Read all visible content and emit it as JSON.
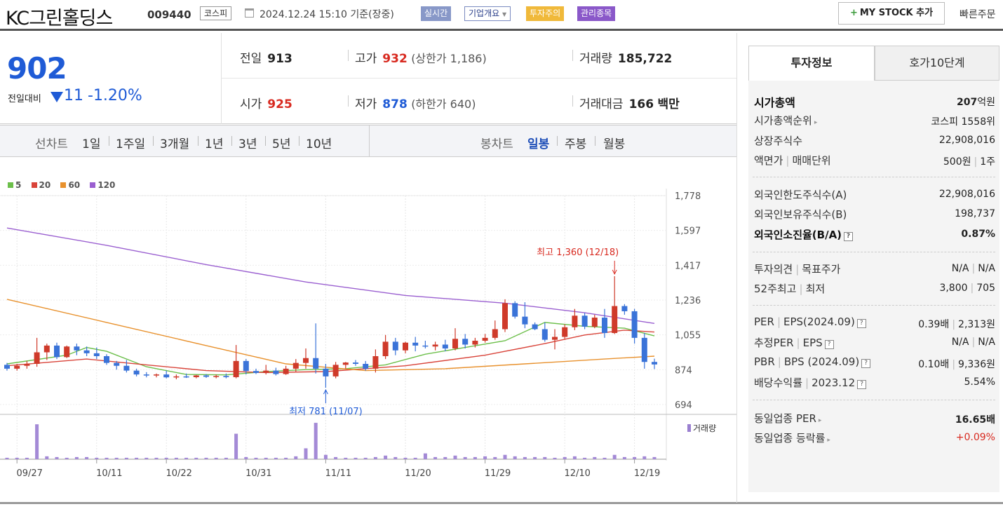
{
  "header": {
    "name": "KC그린홀딩스",
    "code": "009440",
    "market": "코스피",
    "datetime": "2024.12.24 15:10",
    "basis": "기준(장중)",
    "badges": {
      "realtime": "실시간",
      "company": "기업개요",
      "caution": "투자주의",
      "managed": "관리종목"
    },
    "badge_colors": {
      "realtime": "#8898c8",
      "caution": "#f0b93a",
      "managed": "#8a58c9"
    },
    "mystock_label": "MY STOCK 추가",
    "quick_order": "빠른주문"
  },
  "quote": {
    "price": "902",
    "compare_label": "전일대비",
    "change": "11",
    "change_pct": "-1.20%",
    "prev_label": "전일",
    "prev": "913",
    "high_label": "고가",
    "high": "932",
    "upper_limit": "(상한가 1,186)",
    "volume_label": "거래량",
    "volume": "185,722",
    "open_label": "시가",
    "open": "925",
    "low_label": "저가",
    "low": "878",
    "lower_limit": "(하한가 640)",
    "amount_label": "거래대금",
    "amount": "166",
    "amount_unit": "백만"
  },
  "tabs": {
    "line_chart": "선차트",
    "periods": [
      "1일",
      "1주일",
      "3개월",
      "1년",
      "3년",
      "5년",
      "10년"
    ],
    "candle_chart": "봉차트",
    "candle_types": [
      "일봉",
      "주봉",
      "월봉"
    ],
    "active_candle": "일봉"
  },
  "chart_data": {
    "type": "candlestick",
    "legend": [
      {
        "name": "5",
        "color": "#6cbf4a"
      },
      {
        "name": "20",
        "color": "#d9443a"
      },
      {
        "name": "60",
        "color": "#e8912d"
      },
      {
        "name": "120",
        "color": "#9a5fd0"
      }
    ],
    "ylim": [
      694,
      1778
    ],
    "yticks": [
      "1,778",
      "1,597",
      "1,417",
      "1,236",
      "1,055",
      "874",
      "694"
    ],
    "xticks": [
      "09/27",
      "10/11",
      "10/22",
      "10/31",
      "11/11",
      "11/20",
      "11/29",
      "12/10",
      "12/19"
    ],
    "high_annotation": "최고 1,360 (12/18)",
    "low_annotation": "최저 781 (11/07)",
    "volume_label": "거래량",
    "up_color": "#cf3a2a",
    "down_color": "#3a73d8",
    "candles": [
      [
        900,
        910,
        870,
        880
      ],
      [
        880,
        905,
        870,
        895
      ],
      [
        895,
        920,
        880,
        905
      ],
      [
        905,
        1040,
        890,
        965
      ],
      [
        965,
        1010,
        925,
        1000
      ],
      [
        1000,
        1015,
        930,
        940
      ],
      [
        940,
        1000,
        935,
        995
      ],
      [
        995,
        1010,
        950,
        975
      ],
      [
        975,
        995,
        945,
        960
      ],
      [
        960,
        990,
        930,
        945
      ],
      [
        945,
        955,
        900,
        910
      ],
      [
        910,
        920,
        875,
        895
      ],
      [
        895,
        925,
        860,
        870
      ],
      [
        870,
        880,
        840,
        850
      ],
      [
        850,
        862,
        835,
        845
      ],
      [
        845,
        855,
        835,
        850
      ],
      [
        850,
        870,
        830,
        835
      ],
      [
        835,
        850,
        825,
        840
      ],
      [
        840,
        855,
        832,
        836
      ],
      [
        836,
        848,
        830,
        845
      ],
      [
        845,
        852,
        832,
        838
      ],
      [
        838,
        850,
        830,
        842
      ],
      [
        842,
        855,
        830,
        836
      ],
      [
        836,
        1003,
        830,
        920
      ],
      [
        920,
        930,
        850,
        868
      ],
      [
        868,
        880,
        852,
        858
      ],
      [
        858,
        900,
        850,
        870
      ],
      [
        870,
        885,
        845,
        852
      ],
      [
        852,
        895,
        848,
        880
      ],
      [
        880,
        930,
        865,
        910
      ],
      [
        910,
        985,
        880,
        935
      ],
      [
        935,
        1115,
        855,
        880
      ],
      [
        880,
        905,
        781,
        840
      ],
      [
        840,
        915,
        830,
        900
      ],
      [
        900,
        915,
        880,
        912
      ],
      [
        912,
        925,
        895,
        905
      ],
      [
        905,
        920,
        870,
        880
      ],
      [
        880,
        980,
        860,
        945
      ],
      [
        945,
        1055,
        930,
        1020
      ],
      [
        1020,
        1040,
        950,
        975
      ],
      [
        975,
        1020,
        960,
        1015
      ],
      [
        1015,
        1045,
        970,
        1000
      ],
      [
        1000,
        1025,
        985,
        995
      ],
      [
        995,
        1020,
        975,
        1005
      ],
      [
        1005,
        1030,
        970,
        985
      ],
      [
        985,
        1090,
        975,
        1035
      ],
      [
        1035,
        1060,
        985,
        1005
      ],
      [
        1005,
        1040,
        990,
        1025
      ],
      [
        1025,
        1060,
        1015,
        1040
      ],
      [
        1040,
        1130,
        1030,
        1085
      ],
      [
        1085,
        1240,
        1070,
        1220
      ],
      [
        1220,
        1230,
        1140,
        1150
      ],
      [
        1150,
        1225,
        1090,
        1110
      ],
      [
        1110,
        1120,
        1080,
        1085
      ],
      [
        1085,
        1120,
        1020,
        1030
      ],
      [
        1030,
        1085,
        980,
        1045
      ],
      [
        1045,
        1110,
        1030,
        1095
      ],
      [
        1095,
        1190,
        1080,
        1155
      ],
      [
        1155,
        1170,
        1085,
        1098
      ],
      [
        1098,
        1160,
        1090,
        1145
      ],
      [
        1145,
        1190,
        1040,
        1065
      ],
      [
        1065,
        1360,
        1060,
        1205
      ],
      [
        1205,
        1215,
        1160,
        1178
      ],
      [
        1178,
        1190,
        1010,
        1040
      ],
      [
        1040,
        1065,
        880,
        915
      ],
      [
        915,
        932,
        878,
        902
      ]
    ],
    "ma": {
      "5": [
        [
          0,
          905
        ],
        [
          6,
          950
        ],
        [
          8,
          990
        ],
        [
          10,
          970
        ],
        [
          14,
          890
        ],
        [
          18,
          850
        ],
        [
          22,
          848
        ],
        [
          26,
          865
        ],
        [
          30,
          875
        ],
        [
          34,
          880
        ],
        [
          38,
          900
        ],
        [
          42,
          955
        ],
        [
          46,
          990
        ],
        [
          50,
          1025
        ],
        [
          54,
          1120
        ],
        [
          58,
          1100
        ],
        [
          62,
          1090
        ],
        [
          65,
          1050
        ]
      ],
      "20": [
        [
          0,
          895
        ],
        [
          8,
          930
        ],
        [
          14,
          900
        ],
        [
          20,
          870
        ],
        [
          26,
          860
        ],
        [
          32,
          865
        ],
        [
          40,
          895
        ],
        [
          48,
          950
        ],
        [
          54,
          1010
        ],
        [
          58,
          1055
        ],
        [
          62,
          1080
        ],
        [
          65,
          1070
        ]
      ],
      "60": [
        [
          0,
          1240
        ],
        [
          10,
          1120
        ],
        [
          20,
          1000
        ],
        [
          28,
          905
        ],
        [
          36,
          870
        ],
        [
          44,
          880
        ],
        [
          52,
          905
        ],
        [
          60,
          930
        ],
        [
          65,
          945
        ]
      ],
      "120": [
        [
          0,
          1610
        ],
        [
          10,
          1520
        ],
        [
          20,
          1420
        ],
        [
          30,
          1330
        ],
        [
          40,
          1260
        ],
        [
          50,
          1220
        ],
        [
          58,
          1170
        ],
        [
          65,
          1115
        ]
      ]
    },
    "volumes": [
      2,
      2,
      2,
      48,
      4,
      3,
      2,
      3,
      3,
      2,
      2,
      2,
      2,
      2,
      2,
      2,
      2,
      2,
      2,
      2,
      2,
      2,
      2,
      35,
      3,
      2,
      2,
      2,
      2,
      4,
      15,
      50,
      6,
      3,
      2,
      2,
      2,
      3,
      5,
      3,
      2,
      2,
      8,
      3,
      3,
      5,
      3,
      3,
      4,
      3,
      6,
      4,
      3,
      3,
      3,
      2,
      3,
      4,
      2,
      3,
      2,
      6,
      3,
      3,
      4,
      3
    ],
    "xtick_idx": [
      1,
      9,
      16,
      24,
      32,
      40,
      48,
      56,
      63
    ]
  },
  "panel": {
    "tab_invest": "투자정보",
    "tab_orderbook": "호가10단계",
    "market_cap_label": "시가총액",
    "market_cap_num": "207",
    "market_cap_unit": "억원",
    "cap_rank_label": "시가총액순위",
    "cap_rank": "코스피 1558위",
    "shares_label": "상장주식수",
    "shares": "22,908,016",
    "par_label": "액면가",
    "unit_label": "매매단위",
    "par": "500원",
    "unit": "1주",
    "foreign_limit_label": "외국인한도주식수(A)",
    "foreign_limit": "22,908,016",
    "foreign_hold_label": "외국인보유주식수(B)",
    "foreign_hold": "198,737",
    "foreign_ratio_label": "외국인소진율(B/A)",
    "foreign_ratio": "0.87%",
    "opinion_label": "투자의견",
    "target_label": "목표주가",
    "opinion": "N/A",
    "target": "N/A",
    "w52_high_label": "52주최고",
    "w52_low_label": "최저",
    "w52_high": "3,800",
    "w52_low": "705",
    "per_label": "PER",
    "eps_label": "EPS(2024.09)",
    "per": "0.39배",
    "eps": "2,313원",
    "est_per_label": "추정PER",
    "est_eps_label": "EPS",
    "est_per": "N/A",
    "est_eps": "N/A",
    "pbr_label": "PBR",
    "bps_label": "BPS (2024.09)",
    "pbr": "0.10배",
    "bps": "9,336원",
    "dividend_label": "배당수익률",
    "dividend_year": "2023.12",
    "dividend": "5.54%",
    "industry_per_label": "동일업종 PER",
    "industry_per": "16.65배",
    "industry_change_label": "동일업종 등락률",
    "industry_change": "+0.09%"
  }
}
